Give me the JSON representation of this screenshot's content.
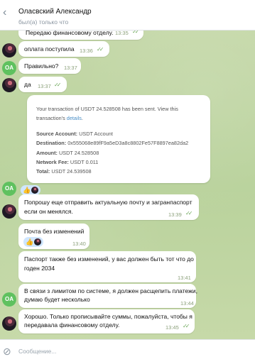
{
  "header": {
    "contact_name": "Оласвский Александр",
    "status": "был(а) только что"
  },
  "messages": {
    "m1": {
      "text": "Передаю финансовому отделу.",
      "time": "13:35"
    },
    "m2": {
      "text": "оплата поступила",
      "time": "13:36"
    },
    "m3": {
      "text": "Правильно?",
      "time": "13:37"
    },
    "m4": {
      "text": "да",
      "time": "13:37"
    },
    "m5": {
      "line1": "Попрошу еще отправить актуальную почту и загранпаспорт",
      "line2": "если он менялся.",
      "time": "13:39"
    },
    "m6": {
      "text": "Почта без изменений",
      "time": "13:40"
    },
    "m7": {
      "line1": "Паспорт также без изменений, у вас должен быть тот что до",
      "line2": "годен 2034",
      "time": "13:41"
    },
    "m8": {
      "line1": "В связи з лимитом по системе, я должен расщепить платежи,",
      "line2": "думаю будет несколько",
      "time": "13:44"
    },
    "m9": {
      "line1": "Хорошо. Только прописывайте суммы, пожалуйста, чтобы я",
      "line2": "передавала финансовому отделу.",
      "time": "13:45"
    }
  },
  "card": {
    "line1": "Your transaction of USDT 24.528508 has been sent. View this",
    "line2_pre": "transaction's ",
    "line2_link": "details",
    "line2_post": ".",
    "source_key": "Source Account:",
    "source_val": "USDT Account",
    "dest_key": "Destination:",
    "dest_val": "0x555068e89fF9a5eD3a8c8802Fe57F8897ea82da2",
    "amount_key": "Amount:",
    "amount_val": "USDT 24.528508",
    "fee_key": "Network Fee:",
    "fee_val": "USDT 0.011",
    "total_key": "Total:",
    "total_val": "USDT 24.539508"
  },
  "avatars": {
    "oa_initials": "OA"
  },
  "reactions": {
    "thumb": "👍"
  },
  "composer": {
    "placeholder": "Сообщение..."
  },
  "icons": [
    "back-arrow-icon",
    "double-check-icon",
    "paperclip-icon",
    "thumbs-up-icon"
  ],
  "colors": {
    "chat_bg": "#c5d8a9",
    "check": "#6da85a",
    "avatar_green": "#5fc15f",
    "link": "#4a8fc7"
  }
}
